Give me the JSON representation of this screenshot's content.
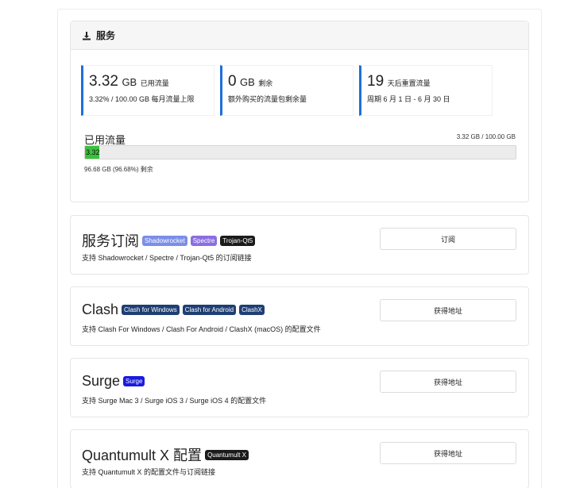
{
  "service": {
    "title": "服务",
    "stats": [
      {
        "big": "3.32",
        "unit": "GB",
        "label": "已用流量",
        "sub": "3.32% / 100.00 GB 每月流量上限"
      },
      {
        "big": "0",
        "unit": "GB",
        "label": "剩余",
        "sub": "额外购买的流量包剩余量"
      },
      {
        "big": "19",
        "unit": "",
        "label": "天后重置流量",
        "sub": "周期 6 月 1 日 - 6 月 30 日"
      }
    ],
    "usage_title": "已用流量",
    "usage_right": "3.32 GB / 100.00 GB",
    "bar_label": "3.32",
    "bar_percent": 3.32,
    "remain": "96.68 GB (96.68%) 剩余"
  },
  "subscriptions": [
    {
      "name": "服务订阅",
      "badges": [
        {
          "label": "Shadowrocket",
          "color": "#7b8ee8"
        },
        {
          "label": "Spectre",
          "color": "#8a6fe0"
        },
        {
          "label": "Trojan-Qt5",
          "color": "#1b1b1b"
        }
      ],
      "desc": "支持 Shadowrocket / Spectre / Trojan-Qt5 的订阅链接",
      "button": "订阅"
    },
    {
      "name": "Clash",
      "badges": [
        {
          "label": "Clash for Windows",
          "color": "#1f3f73"
        },
        {
          "label": "Clash for Android",
          "color": "#1f3f73"
        },
        {
          "label": "ClashX",
          "color": "#1f3f73"
        }
      ],
      "desc": "支持 Clash For Windows / Clash For Android / ClashX (macOS) 的配置文件",
      "button": "获得地址"
    },
    {
      "name": "Surge",
      "badges": [
        {
          "label": "Surge",
          "color": "#1a1ae0"
        }
      ],
      "desc": "支持 Surge Mac 3 / Surge iOS 3 / Surge iOS 4 的配置文件",
      "button": "获得地址"
    },
    {
      "name": "Quantumult X 配置",
      "badges": [
        {
          "label": "Quantumult X",
          "color": "#1b1b1b"
        }
      ],
      "desc": "支持 Quantumult X 的配置文件与订阅链接",
      "button": "获得地址"
    }
  ]
}
